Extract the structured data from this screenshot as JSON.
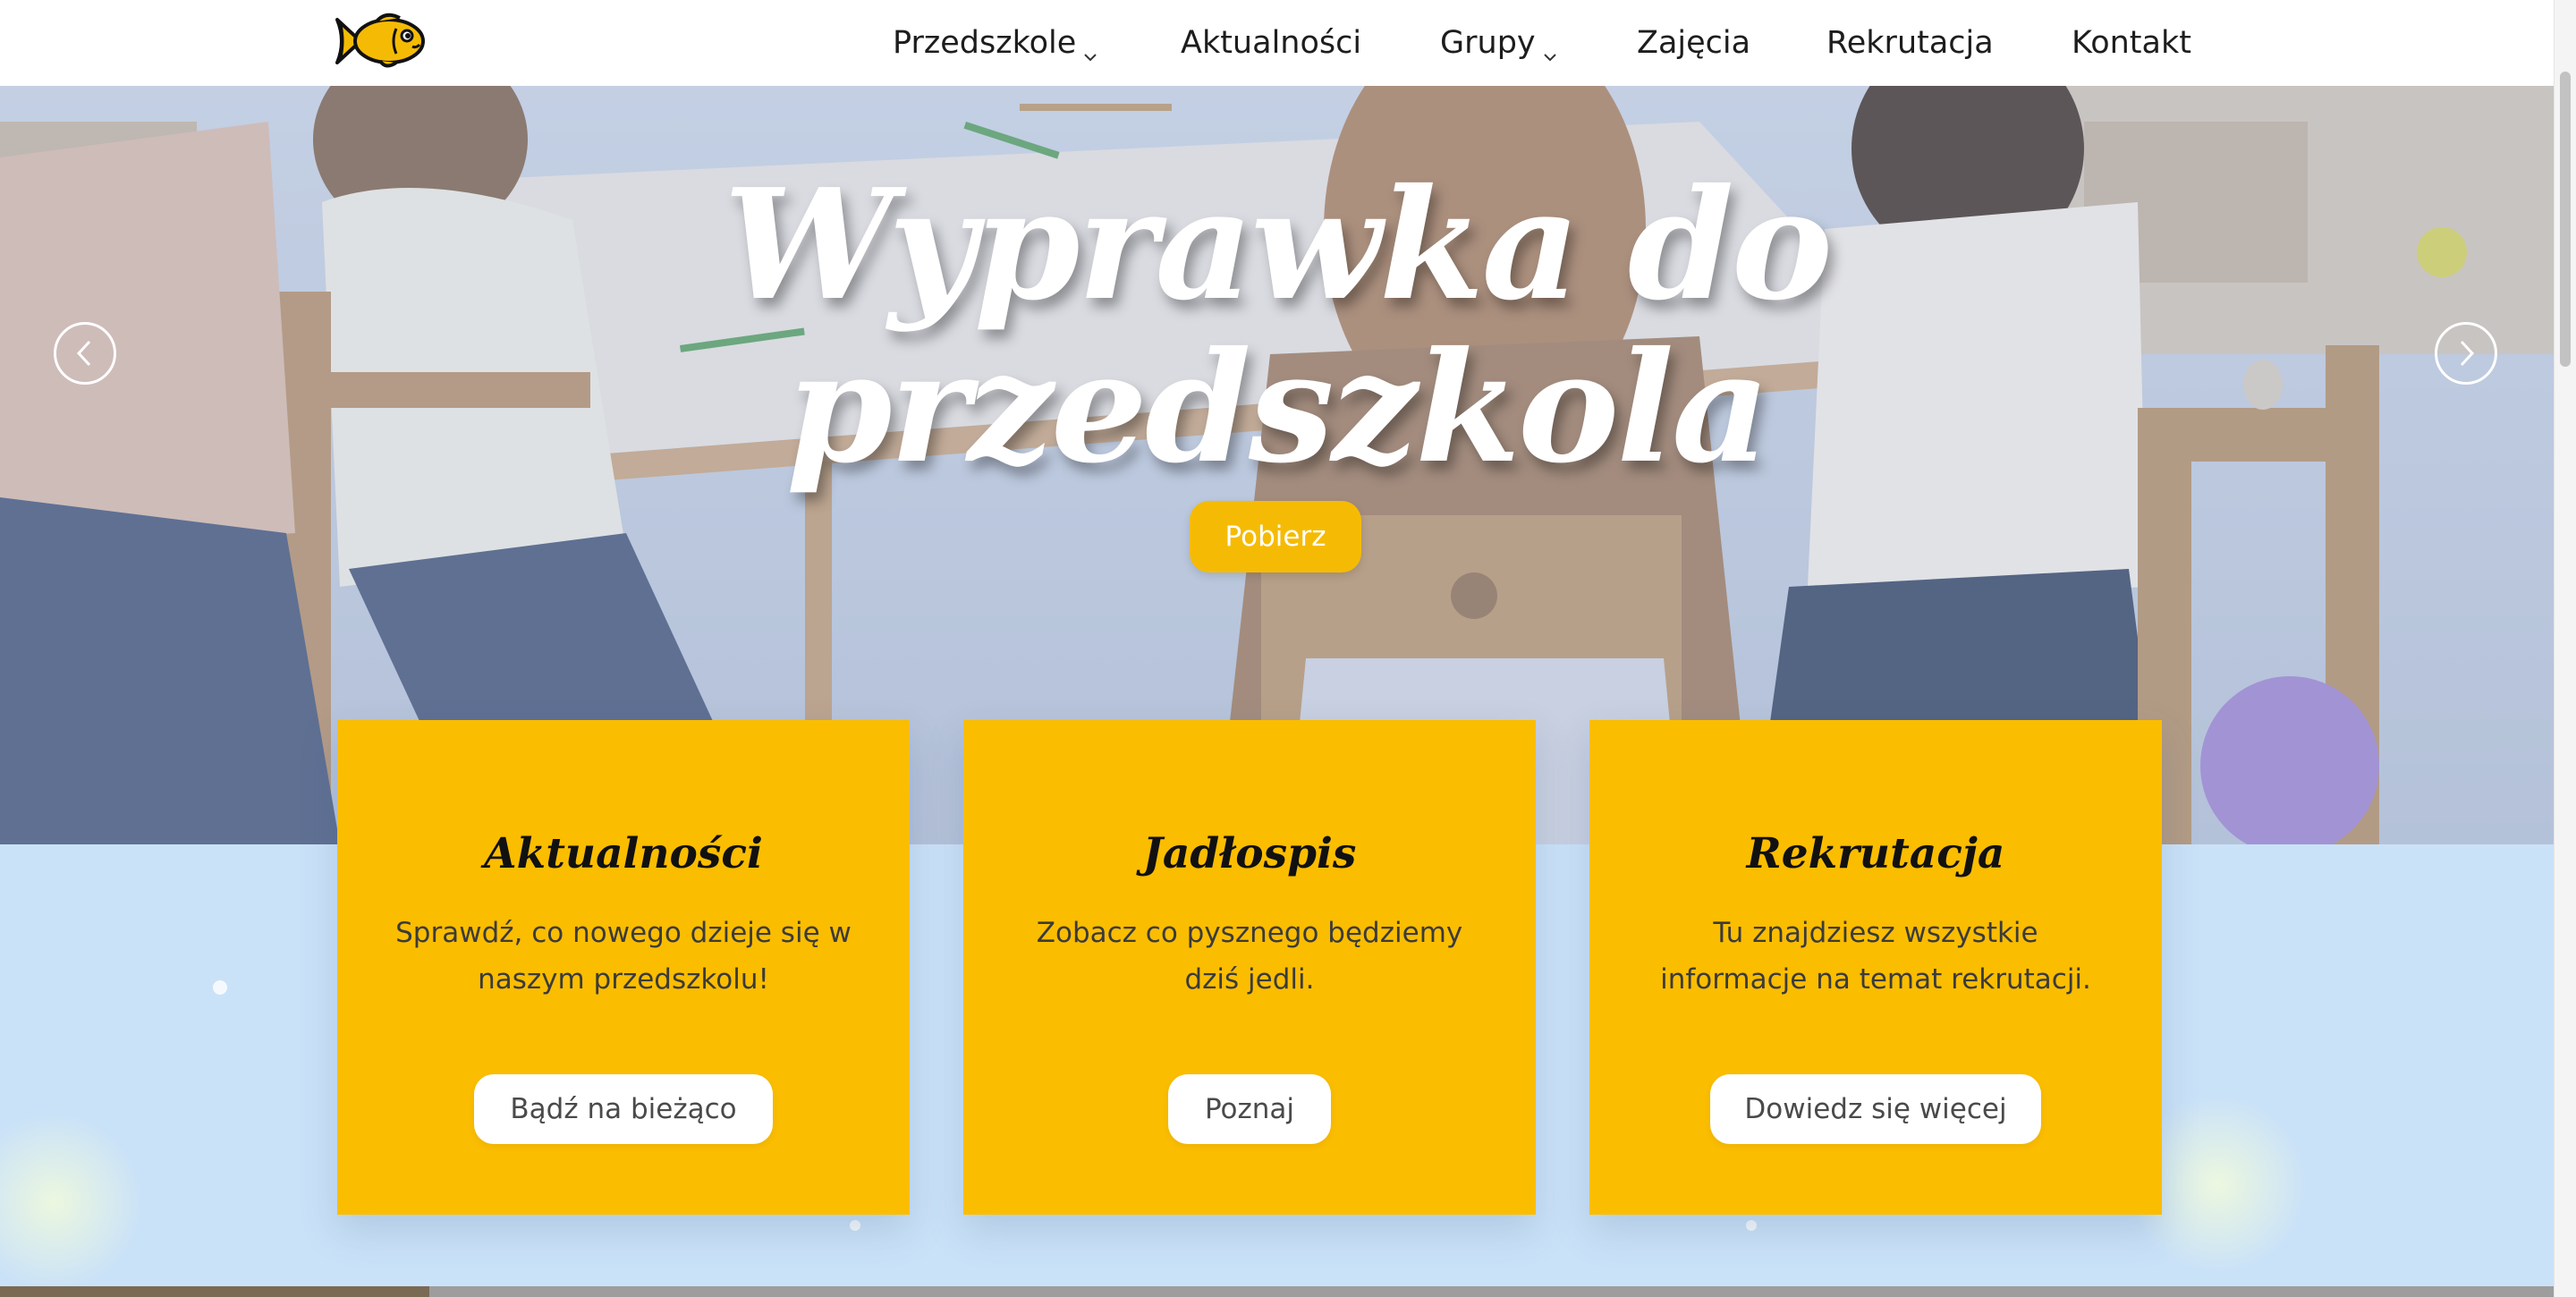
{
  "nav": {
    "logo_icon": "goldfish-logo-icon",
    "items": [
      {
        "label": "Przedszkole",
        "has_dropdown": true
      },
      {
        "label": "Aktualności",
        "has_dropdown": false
      },
      {
        "label": "Grupy",
        "has_dropdown": true
      },
      {
        "label": "Zajęcia",
        "has_dropdown": false
      },
      {
        "label": "Rekrutacja",
        "has_dropdown": false
      },
      {
        "label": "Kontakt",
        "has_dropdown": false
      }
    ]
  },
  "hero": {
    "title_line1": "Wyprawka do",
    "title_line2": "przedszkola",
    "button_label": "Pobierz",
    "prev_icon": "chevron-left-icon",
    "next_icon": "chevron-right-icon"
  },
  "cards": [
    {
      "title": "Aktualności",
      "text": "Sprawdź, co nowego dzieje się w naszym przedszkolu!",
      "button": "Bądź na bieżąco"
    },
    {
      "title": "Jadłospis",
      "text": "Zobacz co pysznego będziemy dziś jedli.",
      "button": "Poznaj"
    },
    {
      "title": "Rekrutacja",
      "text": "Tu znajdziesz wszystkie informacje na temat rekrutacji.",
      "button": "Dowiedz się więcej"
    }
  ],
  "colors": {
    "accent_yellow": "#fbbd00",
    "hero_button": "#f5bb04",
    "section_blue": "#cae2f8",
    "nav_text": "#1d1d1d"
  }
}
